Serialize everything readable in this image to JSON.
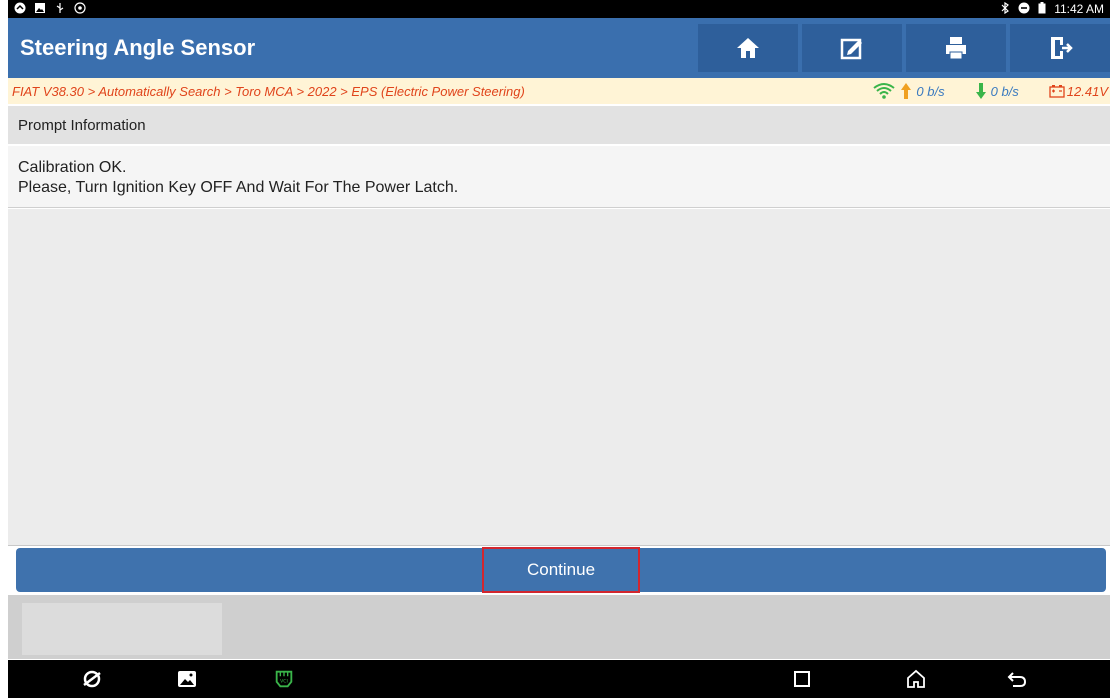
{
  "status_bar": {
    "time": "11:42 AM",
    "left_icons": [
      "app-circle-icon",
      "gallery-icon",
      "usb-icon",
      "settings-circle-icon"
    ],
    "right_icons": [
      "bluetooth-icon",
      "dnd-icon",
      "battery-icon"
    ]
  },
  "header": {
    "title": "Steering Angle Sensor",
    "buttons": [
      "home-icon",
      "edit-icon",
      "print-icon",
      "exit-icon"
    ],
    "bg_color": "#3a6fae"
  },
  "breadcrumb": {
    "path": "FIAT V38.30 > Automatically Search > Toro MCA > 2022 > EPS (Electric Power Steering)",
    "upload_rate": "0 b/s",
    "download_rate": "0 b/s",
    "voltage": "12.41V",
    "color": "#e0441b"
  },
  "prompt": {
    "section_title": "Prompt Information",
    "line1": "Calibration OK.",
    "line2": "Please, Turn Ignition Key OFF And Wait For The Power Latch."
  },
  "actions": {
    "continue_label": "Continue",
    "highlight_color": "#d2262e"
  },
  "nav_bar": {
    "items": [
      "browser-icon",
      "gallery-icon",
      "vci-icon",
      "recent-apps-icon",
      "home-nav-icon",
      "back-icon"
    ]
  }
}
